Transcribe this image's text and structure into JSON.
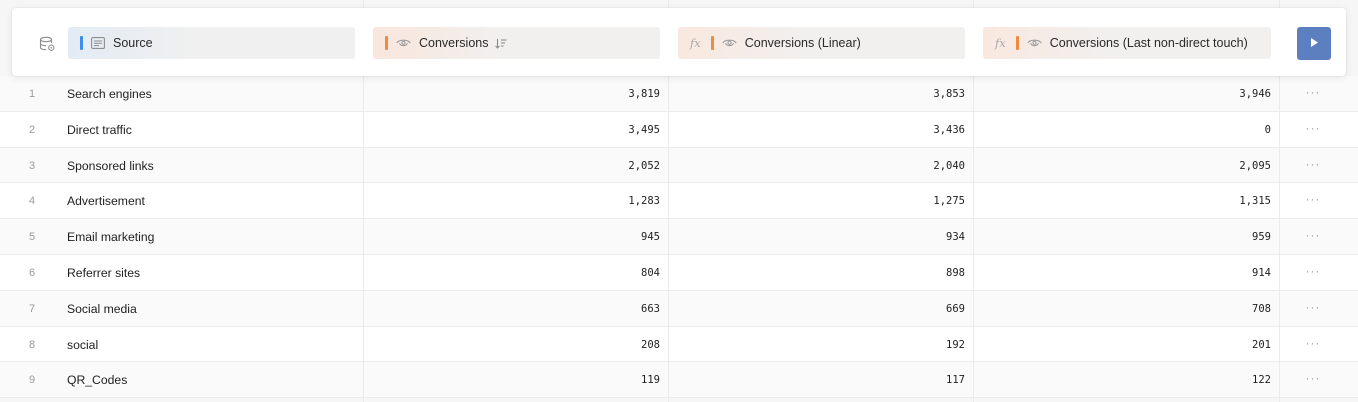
{
  "header": {
    "source": {
      "label": "Source",
      "icon": "table-column-icon",
      "accent": "#3e8fe8"
    },
    "conversions": {
      "label": "Conversions",
      "icon": "eye-icon",
      "sort_icon": "sort-descending-icon",
      "accent": "#f08a3c"
    },
    "linear": {
      "label": "Conversions (Linear)",
      "formula_badge": "fx",
      "icon": "eye-icon",
      "accent": "#f08a3c"
    },
    "last_touch": {
      "label": "Conversions (Last non-direct touch)",
      "formula_badge": "fx",
      "icon": "eye-icon",
      "accent": "#f08a3c"
    },
    "datasource_icon": "database-settings-icon",
    "run_button_icon": "play-icon",
    "run_button_color": "#5b7fbf"
  },
  "rows": [
    {
      "index": "1",
      "source": "Search engines",
      "conversions": "3,819",
      "linear": "3,853",
      "last_touch": "3,946",
      "more": "···"
    },
    {
      "index": "2",
      "source": "Direct traffic",
      "conversions": "3,495",
      "linear": "3,436",
      "last_touch": "0",
      "more": "···"
    },
    {
      "index": "3",
      "source": "Sponsored links",
      "conversions": "2,052",
      "linear": "2,040",
      "last_touch": "2,095",
      "more": "···"
    },
    {
      "index": "4",
      "source": "Advertisement",
      "conversions": "1,283",
      "linear": "1,275",
      "last_touch": "1,315",
      "more": "···"
    },
    {
      "index": "5",
      "source": "Email marketing",
      "conversions": "945",
      "linear": "934",
      "last_touch": "959",
      "more": "···"
    },
    {
      "index": "6",
      "source": "Referrer sites",
      "conversions": "804",
      "linear": "898",
      "last_touch": "914",
      "more": "···"
    },
    {
      "index": "7",
      "source": "Social media",
      "conversions": "663",
      "linear": "669",
      "last_touch": "708",
      "more": "···"
    },
    {
      "index": "8",
      "source": "social",
      "conversions": "208",
      "linear": "192",
      "last_touch": "201",
      "more": "···"
    },
    {
      "index": "9",
      "source": "QR_Codes",
      "conversions": "119",
      "linear": "117",
      "last_touch": "122",
      "more": "···"
    }
  ]
}
